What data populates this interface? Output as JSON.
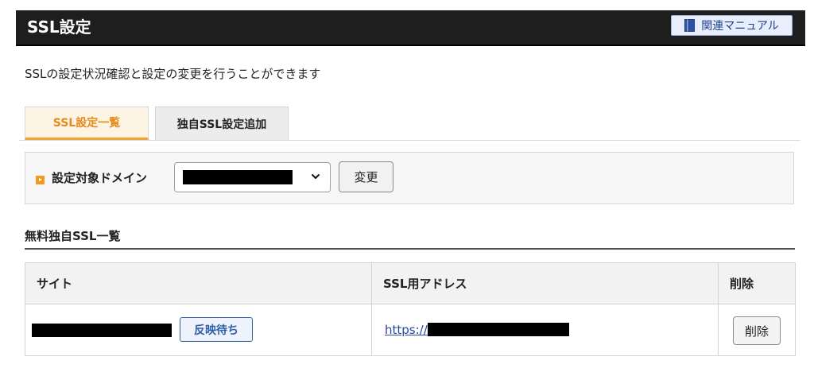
{
  "header": {
    "title": "SSL設定",
    "manual_label": "関連マニュアル"
  },
  "intro": "SSLの設定状況確認と設定の変更を行うことができます",
  "tabs": [
    {
      "label": "SSL設定一覧",
      "active": true
    },
    {
      "label": "独自SSL設定追加",
      "active": false
    }
  ],
  "domain_selector": {
    "label": "設定対象ドメイン",
    "selected_value": "",
    "change_label": "変更"
  },
  "section": {
    "heading": "無料独自SSL一覧"
  },
  "table": {
    "columns": [
      "サイト",
      "SSL用アドレス",
      "削除"
    ],
    "rows": [
      {
        "site": "",
        "status": "反映待ち",
        "address_prefix": "https://",
        "delete_label": "削除"
      }
    ]
  },
  "colors": {
    "header_bg": "#1e1e1e",
    "tab_active": "#e68a19",
    "status_badge": "#2f5fa8",
    "link": "#2848a3"
  },
  "icons": [
    "book-icon",
    "chevron-down-icon",
    "marker-icon"
  ]
}
